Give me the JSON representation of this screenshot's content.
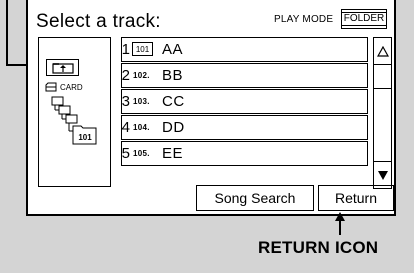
{
  "screen": {
    "title": "Select a track:",
    "play_mode_label": "PLAY MODE",
    "folder_button": "FOLDER"
  },
  "folder_panel": {
    "card_label": "CARD",
    "current_folder_label": "101"
  },
  "tracks": [
    {
      "number": "1",
      "index": "101",
      "name": "AA",
      "index_boxed": true
    },
    {
      "number": "2",
      "index": "102.",
      "name": "BB"
    },
    {
      "number": "3",
      "index": "103.",
      "name": "CC"
    },
    {
      "number": "4",
      "index": "104.",
      "name": "DD"
    },
    {
      "number": "5",
      "index": "105.",
      "name": "EE"
    }
  ],
  "buttons": {
    "song_search": "Song Search",
    "return": "Return"
  },
  "callout": {
    "return_icon_label": "RETURN ICON"
  },
  "icons": {
    "up_folder": "folder-up-icon",
    "card": "card-icon",
    "scroll_up": "triangle-up-icon",
    "scroll_down": "triangle-down-icon"
  },
  "colors": {
    "page_background": "#d4d4d4",
    "screen_background": "#ffffff",
    "line": "#000000"
  }
}
